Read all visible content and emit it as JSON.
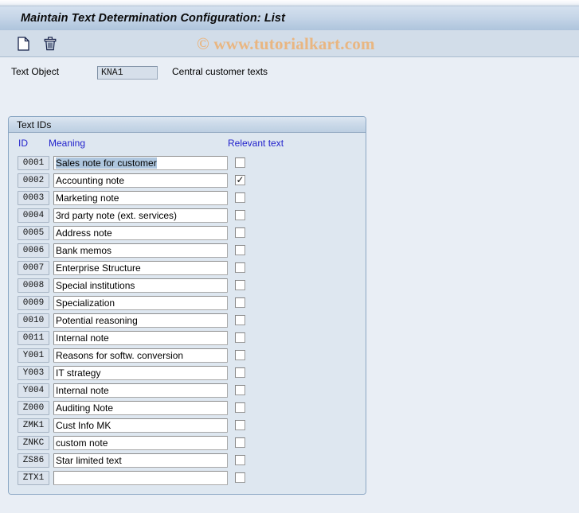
{
  "window": {
    "title": "Maintain Text Determination Configuration: List"
  },
  "toolbar": {
    "new_label": "",
    "delete_label": "",
    "icons": [
      "new-document-icon",
      "delete-trash-icon"
    ]
  },
  "watermark": {
    "text": "© www.tutorialkart.com",
    "color": "#e9b681"
  },
  "header_field": {
    "label": "Text Object",
    "value": "KNA1",
    "description": "Central customer texts"
  },
  "group": {
    "title": "Text IDs",
    "columns": {
      "id": "ID",
      "meaning": "Meaning",
      "relevant": "Relevant text"
    },
    "header_color": "#2222cc",
    "rows": [
      {
        "id": "0001",
        "meaning": "Sales note for customer",
        "relevant": false,
        "selected": true
      },
      {
        "id": "0002",
        "meaning": "Accounting note",
        "relevant": true,
        "selected": false
      },
      {
        "id": "0003",
        "meaning": "Marketing note",
        "relevant": false,
        "selected": false
      },
      {
        "id": "0004",
        "meaning": "3rd party note (ext. services)",
        "relevant": false,
        "selected": false
      },
      {
        "id": "0005",
        "meaning": "Address note",
        "relevant": false,
        "selected": false
      },
      {
        "id": "0006",
        "meaning": "Bank memos",
        "relevant": false,
        "selected": false
      },
      {
        "id": "0007",
        "meaning": "Enterprise Structure",
        "relevant": false,
        "selected": false
      },
      {
        "id": "0008",
        "meaning": "Special institutions",
        "relevant": false,
        "selected": false
      },
      {
        "id": "0009",
        "meaning": "Specialization",
        "relevant": false,
        "selected": false
      },
      {
        "id": "0010",
        "meaning": "Potential reasoning",
        "relevant": false,
        "selected": false
      },
      {
        "id": "0011",
        "meaning": "Internal note",
        "relevant": false,
        "selected": false
      },
      {
        "id": "Y001",
        "meaning": "Reasons for softw. conversion",
        "relevant": false,
        "selected": false
      },
      {
        "id": "Y003",
        "meaning": "IT strategy",
        "relevant": false,
        "selected": false
      },
      {
        "id": "Y004",
        "meaning": "Internal note",
        "relevant": false,
        "selected": false
      },
      {
        "id": "Z000",
        "meaning": "Auditing Note",
        "relevant": false,
        "selected": false
      },
      {
        "id": "ZMK1",
        "meaning": "Cust Info MK",
        "relevant": false,
        "selected": false
      },
      {
        "id": "ZNKC",
        "meaning": "custom note",
        "relevant": false,
        "selected": false
      },
      {
        "id": "ZS86",
        "meaning": "Star limited text",
        "relevant": false,
        "selected": false
      },
      {
        "id": "ZTX1",
        "meaning": "",
        "relevant": false,
        "selected": false
      }
    ],
    "checked_glyph": "✓"
  },
  "colors": {
    "page_background": "#e9eef5",
    "titlebar_start": "#d4e0ee",
    "titlebar_end": "#aec4dc",
    "toolbar": "#d2dde9",
    "panel_background": "#dee7f0",
    "panel_border": "#8ba7c4",
    "selection": "#aec6de"
  }
}
